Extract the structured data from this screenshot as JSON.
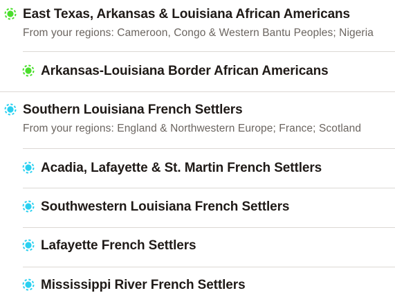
{
  "colors": {
    "green_region": "#4ade2c",
    "cyan_region": "#2ad0f0",
    "text": "#1f1a17",
    "subtext": "#6b6560",
    "divider": "#dcd8d4"
  },
  "communities": [
    {
      "title": "East Texas, Arkansas & Louisiana African Americans",
      "subtitle": "From your regions: Cameroon, Congo & Western Bantu Peoples; Nigeria",
      "icon": "community-dot-icon",
      "color": "green"
    },
    {
      "title": "Arkansas-Louisiana Border African Americans",
      "icon": "community-dot-icon",
      "color": "green"
    },
    {
      "title": "Southern Louisiana French Settlers",
      "subtitle": "From your regions: England & Northwestern Europe; France; Scotland",
      "icon": "community-dot-icon",
      "color": "cyan"
    },
    {
      "title": "Acadia, Lafayette & St. Martin French Settlers",
      "icon": "community-dot-icon",
      "color": "cyan"
    },
    {
      "title": "Southwestern Louisiana French Settlers",
      "icon": "community-dot-icon",
      "color": "cyan"
    },
    {
      "title": "Lafayette French Settlers",
      "icon": "community-dot-icon",
      "color": "cyan"
    },
    {
      "title": "Mississippi River French Settlers",
      "icon": "community-dot-icon",
      "color": "cyan"
    }
  ]
}
